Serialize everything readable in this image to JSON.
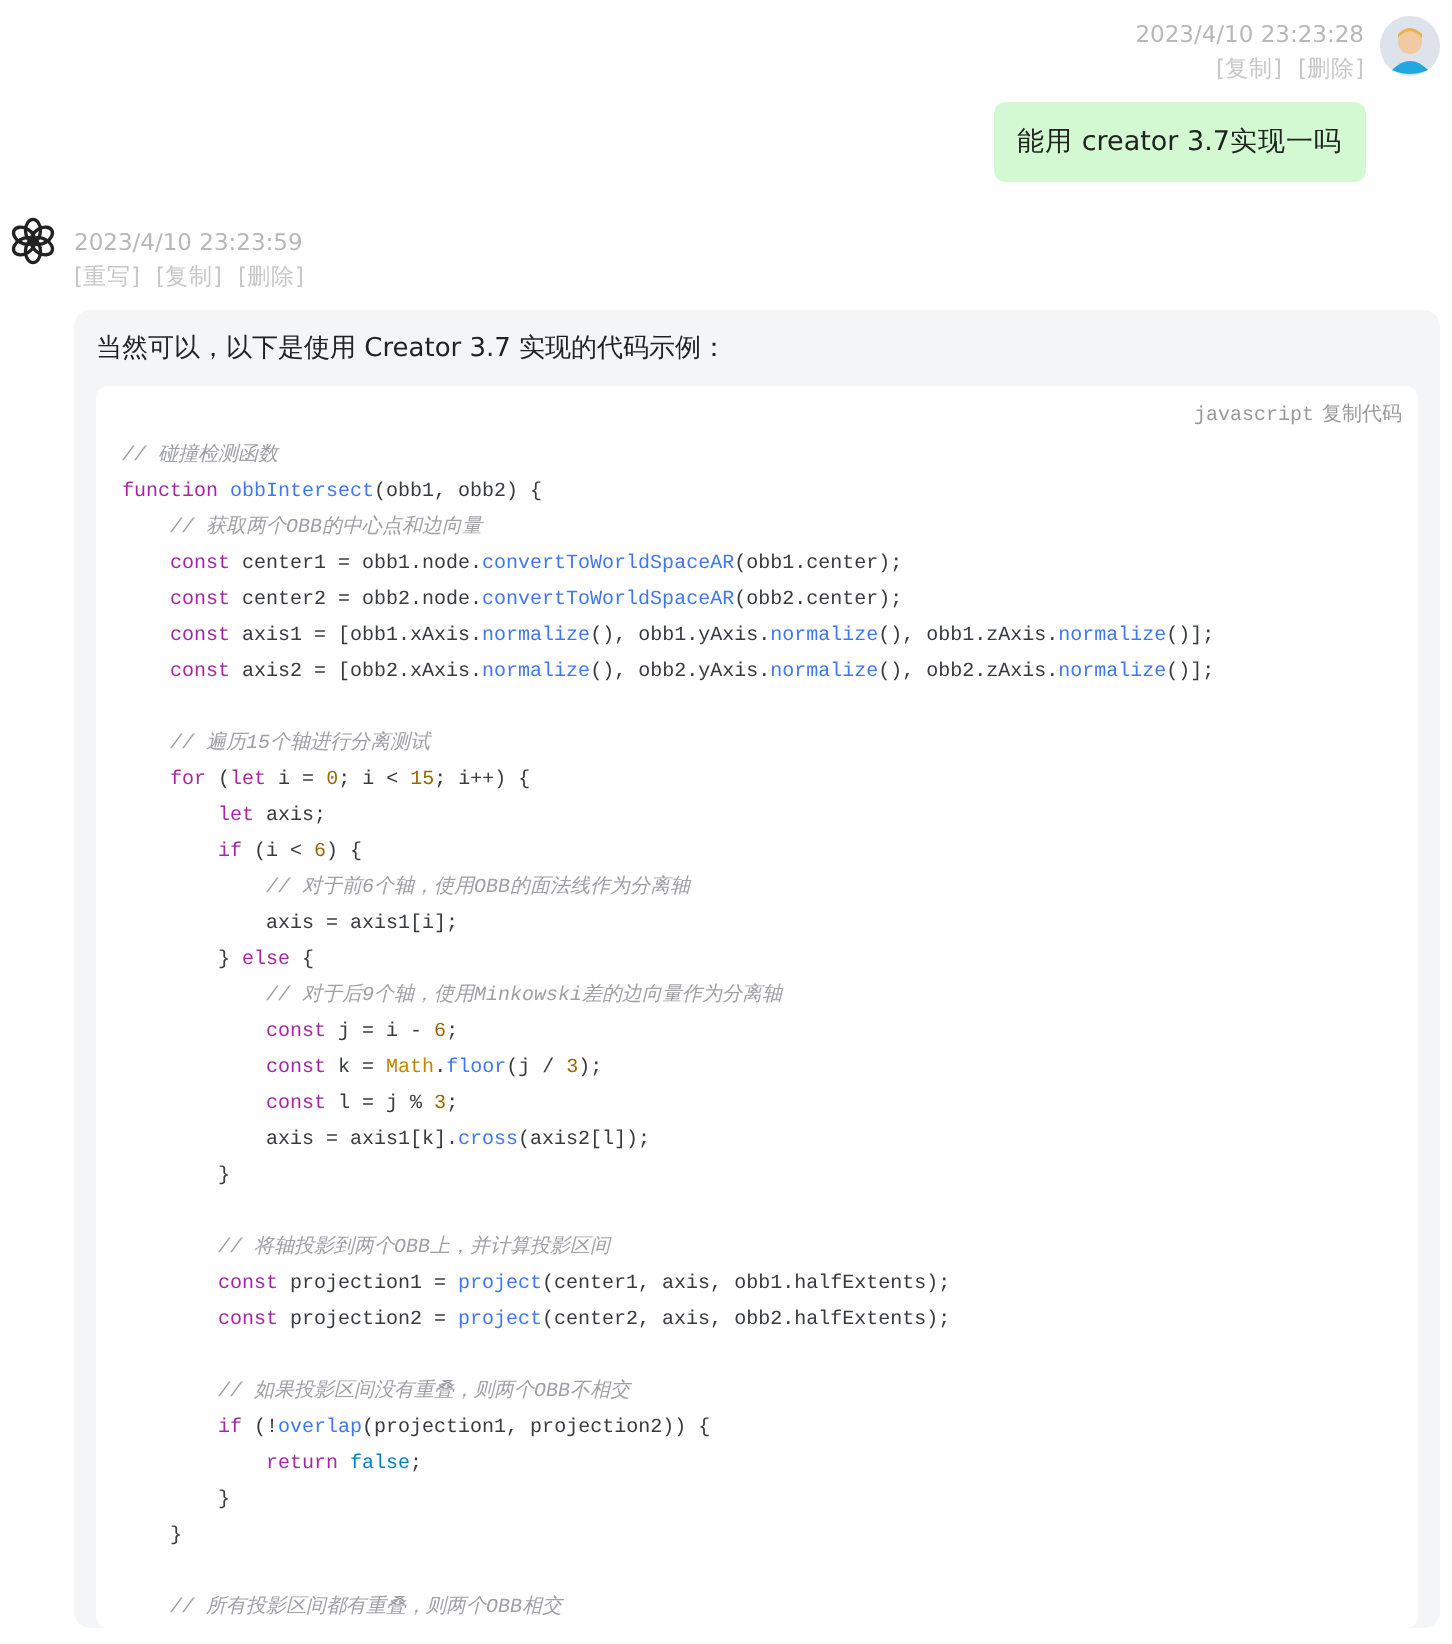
{
  "user_message": {
    "time": "2023/4/10 23:23:28",
    "actions": [
      "[复制]",
      "[删除]"
    ],
    "text": "能用 creator 3.7实现一吗"
  },
  "bot_message": {
    "time": "2023/4/10 23:23:59",
    "actions": [
      "[重写]",
      "[复制]",
      "[删除]"
    ],
    "intro": "当然可以，以下是使用 Creator 3.7 实现的代码示例：",
    "code": {
      "language": "javascript",
      "copy_label": "复制代码",
      "lines": [
        {
          "kind": "code",
          "tokens": [
            {
              "kind": "comment",
              "text": "// 碰撞检测函数"
            }
          ]
        },
        {
          "kind": "code",
          "tokens": [
            {
              "kind": "keyword",
              "text": "function "
            },
            {
              "kind": "title",
              "text": "obbIntersect"
            },
            {
              "kind": "plain",
              "text": "(obb1, obb2) {"
            }
          ]
        },
        {
          "kind": "code",
          "tokens": [
            {
              "kind": "comment",
              "text": "    // 获取两个OBB的中心点和边向量"
            }
          ]
        },
        {
          "kind": "code",
          "tokens": [
            {
              "kind": "keyword",
              "text": "    const"
            },
            {
              "kind": "plain",
              "text": " center1 = obb1.node."
            },
            {
              "kind": "title",
              "text": "convertToWorldSpaceAR"
            },
            {
              "kind": "plain",
              "text": "(obb1.center);"
            }
          ]
        },
        {
          "kind": "code",
          "tokens": [
            {
              "kind": "keyword",
              "text": "    const"
            },
            {
              "kind": "plain",
              "text": " center2 = obb2.node."
            },
            {
              "kind": "title",
              "text": "convertToWorldSpaceAR"
            },
            {
              "kind": "plain",
              "text": "(obb2.center);"
            }
          ]
        },
        {
          "kind": "code",
          "tokens": [
            {
              "kind": "keyword",
              "text": "    const"
            },
            {
              "kind": "plain",
              "text": " axis1 = [obb1.xAxis."
            },
            {
              "kind": "title",
              "text": "normalize"
            },
            {
              "kind": "plain",
              "text": "(), obb1.yAxis."
            },
            {
              "kind": "title",
              "text": "normalize"
            },
            {
              "kind": "plain",
              "text": "(), obb1.zAxis."
            },
            {
              "kind": "title",
              "text": "normalize"
            },
            {
              "kind": "plain",
              "text": "()];"
            }
          ]
        },
        {
          "kind": "code",
          "tokens": [
            {
              "kind": "keyword",
              "text": "    const"
            },
            {
              "kind": "plain",
              "text": " axis2 = [obb2.xAxis."
            },
            {
              "kind": "title",
              "text": "normalize"
            },
            {
              "kind": "plain",
              "text": "(), obb2.yAxis."
            },
            {
              "kind": "title",
              "text": "normalize"
            },
            {
              "kind": "plain",
              "text": "(), obb2.zAxis."
            },
            {
              "kind": "title",
              "text": "normalize"
            },
            {
              "kind": "plain",
              "text": "()];"
            }
          ]
        },
        {
          "kind": "blank"
        },
        {
          "kind": "code",
          "tokens": [
            {
              "kind": "comment",
              "text": "    // 遍历15个轴进行分离测试"
            }
          ]
        },
        {
          "kind": "code",
          "tokens": [
            {
              "kind": "keyword",
              "text": "    for"
            },
            {
              "kind": "plain",
              "text": " ("
            },
            {
              "kind": "keyword",
              "text": "let"
            },
            {
              "kind": "plain",
              "text": " i = "
            },
            {
              "kind": "number",
              "text": "0"
            },
            {
              "kind": "plain",
              "text": "; i < "
            },
            {
              "kind": "number",
              "text": "15"
            },
            {
              "kind": "plain",
              "text": "; i++) {"
            }
          ]
        },
        {
          "kind": "code",
          "tokens": [
            {
              "kind": "keyword",
              "text": "        let"
            },
            {
              "kind": "plain",
              "text": " axis;"
            }
          ]
        },
        {
          "kind": "code",
          "tokens": [
            {
              "kind": "keyword",
              "text": "        if"
            },
            {
              "kind": "plain",
              "text": " (i < "
            },
            {
              "kind": "number",
              "text": "6"
            },
            {
              "kind": "plain",
              "text": ") {"
            }
          ]
        },
        {
          "kind": "code",
          "tokens": [
            {
              "kind": "comment",
              "text": "            // 对于前6个轴，使用OBB的面法线作为分离轴"
            }
          ]
        },
        {
          "kind": "code",
          "tokens": [
            {
              "kind": "plain",
              "text": "            axis = axis1[i];"
            }
          ]
        },
        {
          "kind": "code",
          "tokens": [
            {
              "kind": "plain",
              "text": "        } "
            },
            {
              "kind": "keyword",
              "text": "else"
            },
            {
              "kind": "plain",
              "text": " {"
            }
          ]
        },
        {
          "kind": "code",
          "tokens": [
            {
              "kind": "comment",
              "text": "            // 对于后9个轴，使用Minkowski差的边向量作为分离轴"
            }
          ]
        },
        {
          "kind": "code",
          "tokens": [
            {
              "kind": "keyword",
              "text": "            const"
            },
            {
              "kind": "plain",
              "text": " j = i - "
            },
            {
              "kind": "number",
              "text": "6"
            },
            {
              "kind": "plain",
              "text": ";"
            }
          ]
        },
        {
          "kind": "code",
          "tokens": [
            {
              "kind": "keyword",
              "text": "            const"
            },
            {
              "kind": "plain",
              "text": " k = "
            },
            {
              "kind": "builtin",
              "text": "Math"
            },
            {
              "kind": "plain",
              "text": "."
            },
            {
              "kind": "title",
              "text": "floor"
            },
            {
              "kind": "plain",
              "text": "(j / "
            },
            {
              "kind": "number",
              "text": "3"
            },
            {
              "kind": "plain",
              "text": ");"
            }
          ]
        },
        {
          "kind": "code",
          "tokens": [
            {
              "kind": "keyword",
              "text": "            const"
            },
            {
              "kind": "plain",
              "text": " l = j % "
            },
            {
              "kind": "number",
              "text": "3"
            },
            {
              "kind": "plain",
              "text": ";"
            }
          ]
        },
        {
          "kind": "code",
          "tokens": [
            {
              "kind": "plain",
              "text": "            axis = axis1[k]."
            },
            {
              "kind": "title",
              "text": "cross"
            },
            {
              "kind": "plain",
              "text": "(axis2[l]);"
            }
          ]
        },
        {
          "kind": "code",
          "tokens": [
            {
              "kind": "plain",
              "text": "        }"
            }
          ]
        },
        {
          "kind": "blank"
        },
        {
          "kind": "code",
          "tokens": [
            {
              "kind": "comment",
              "text": "        // 将轴投影到两个OBB上，并计算投影区间"
            }
          ]
        },
        {
          "kind": "code",
          "tokens": [
            {
              "kind": "keyword",
              "text": "        const"
            },
            {
              "kind": "plain",
              "text": " projection1 = "
            },
            {
              "kind": "title",
              "text": "project"
            },
            {
              "kind": "plain",
              "text": "(center1, axis, obb1.halfExtents);"
            }
          ]
        },
        {
          "kind": "code",
          "tokens": [
            {
              "kind": "keyword",
              "text": "        const"
            },
            {
              "kind": "plain",
              "text": " projection2 = "
            },
            {
              "kind": "title",
              "text": "project"
            },
            {
              "kind": "plain",
              "text": "(center2, axis, obb2.halfExtents);"
            }
          ]
        },
        {
          "kind": "blank"
        },
        {
          "kind": "code",
          "tokens": [
            {
              "kind": "comment",
              "text": "        // 如果投影区间没有重叠，则两个OBB不相交"
            }
          ]
        },
        {
          "kind": "code",
          "tokens": [
            {
              "kind": "keyword",
              "text": "        if"
            },
            {
              "kind": "plain",
              "text": " (!"
            },
            {
              "kind": "title",
              "text": "overlap"
            },
            {
              "kind": "plain",
              "text": "(projection1, projection2)) {"
            }
          ]
        },
        {
          "kind": "code",
          "tokens": [
            {
              "kind": "keyword",
              "text": "            return"
            },
            {
              "kind": "literal",
              "text": " false"
            },
            {
              "kind": "plain",
              "text": ";"
            }
          ]
        },
        {
          "kind": "code",
          "tokens": [
            {
              "kind": "plain",
              "text": "        }"
            }
          ]
        },
        {
          "kind": "code",
          "tokens": [
            {
              "kind": "plain",
              "text": "    }"
            }
          ]
        },
        {
          "kind": "blank"
        },
        {
          "kind": "code",
          "tokens": [
            {
              "kind": "comment",
              "text": "    // 所有投影区间都有重叠，则两个OBB相交"
            }
          ]
        }
      ]
    }
  }
}
